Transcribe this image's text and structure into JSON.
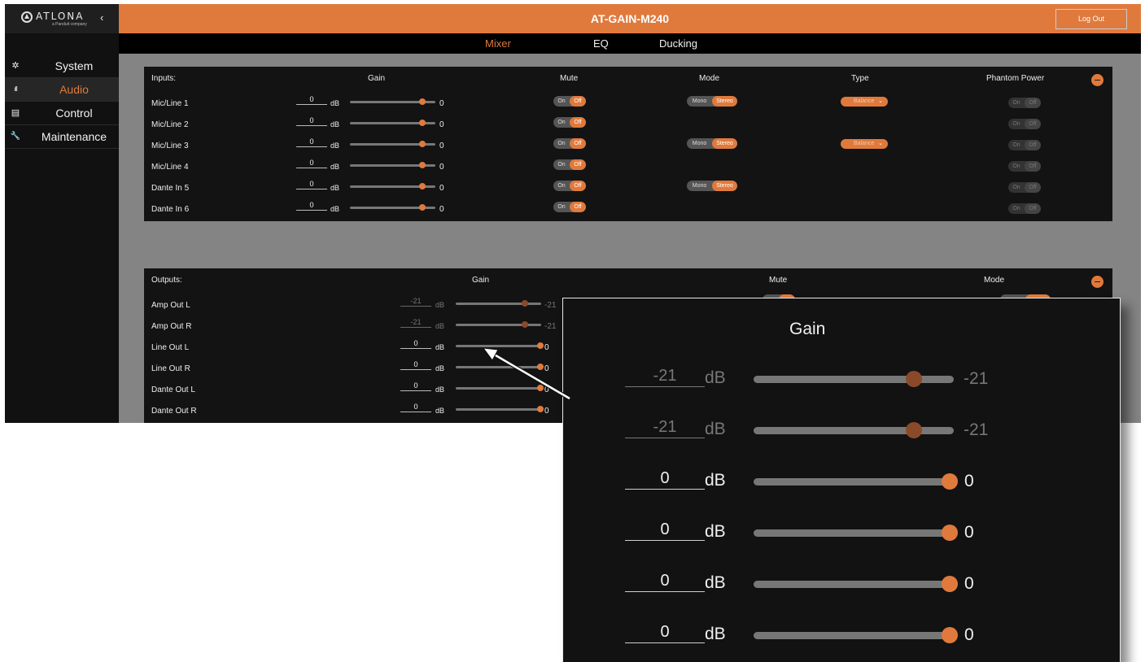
{
  "app": {
    "title": "AT-GAIN-M240",
    "logout_label": "Log Out",
    "brand": "ATLONA",
    "brand_sub": "a Panduit company",
    "accent_color": "#e07a3c"
  },
  "sidebar": {
    "collapse_glyph": "‹",
    "items": [
      {
        "label": "System",
        "icon": "gear-icon",
        "glyph": "✲",
        "active": false
      },
      {
        "label": "Audio",
        "icon": "audio-waveform-icon",
        "glyph": "ıII",
        "active": true
      },
      {
        "label": "Control",
        "icon": "clipboard-icon",
        "glyph": "▤",
        "active": false
      },
      {
        "label": "Maintenance",
        "icon": "wrench-icon",
        "glyph": "🔧",
        "active": false
      }
    ]
  },
  "tabs": [
    {
      "label": "Mixer",
      "active": true
    },
    {
      "label": "EQ",
      "active": false
    },
    {
      "label": "Ducking",
      "active": false
    }
  ],
  "inputs": {
    "headers": {
      "section": "Inputs:",
      "gain": "Gain",
      "mute": "Mute",
      "mode": "Mode",
      "type": "Type",
      "phantom": "Phantom Power"
    },
    "rows": [
      {
        "label": "Mic/Line 1",
        "gain": "0",
        "unit": "dB",
        "readout": "0",
        "level": 1.0,
        "mute": {
          "on": "On",
          "off": "Off"
        },
        "mode": {
          "a": "Mono",
          "b": "Stereo"
        },
        "type": "Balance",
        "phantom": {
          "on": "On",
          "off": "Off"
        }
      },
      {
        "label": "Mic/Line 2",
        "gain": "0",
        "unit": "dB",
        "readout": "0",
        "level": 1.0,
        "mute": {
          "on": "On",
          "off": "Off"
        },
        "phantom": {
          "on": "On",
          "off": "Off"
        }
      },
      {
        "label": "Mic/Line 3",
        "gain": "0",
        "unit": "dB",
        "readout": "0",
        "level": 1.0,
        "mute": {
          "on": "On",
          "off": "Off"
        },
        "mode": {
          "a": "Mono",
          "b": "Stereo"
        },
        "type": "Balance",
        "phantom": {
          "on": "On",
          "off": "Off"
        }
      },
      {
        "label": "Mic/Line 4",
        "gain": "0",
        "unit": "dB",
        "readout": "0",
        "level": 1.0,
        "mute": {
          "on": "On",
          "off": "Off"
        },
        "phantom": {
          "on": "On",
          "off": "Off"
        }
      },
      {
        "label": "Dante In 5",
        "gain": "0",
        "unit": "dB",
        "readout": "0",
        "level": 1.0,
        "mute": {
          "on": "On",
          "off": "Off"
        },
        "mode": {
          "a": "Mono",
          "b": "Stereo"
        },
        "phantom": {
          "on": "On",
          "off": "Off"
        }
      },
      {
        "label": "Dante In 6",
        "gain": "0",
        "unit": "dB",
        "readout": "0",
        "level": 1.0,
        "mute": {
          "on": "On",
          "off": "Off"
        },
        "phantom": {
          "on": "On",
          "off": "Off"
        }
      }
    ]
  },
  "outputs": {
    "headers": {
      "section": "Outputs:",
      "gain": "Gain",
      "mute": "Mute",
      "mode": "Mode"
    },
    "rows": [
      {
        "label": "Amp Out L",
        "gain": "-21",
        "unit": "dB",
        "readout": "-21",
        "level": 0.82,
        "disabled": true
      },
      {
        "label": "Amp Out R",
        "gain": "-21",
        "unit": "dB",
        "readout": "-21",
        "level": 0.82,
        "disabled": true
      },
      {
        "label": "Line Out L",
        "gain": "0",
        "unit": "dB",
        "readout": "0",
        "level": 1.0,
        "disabled": false
      },
      {
        "label": "Line Out R",
        "gain": "0",
        "unit": "dB",
        "readout": "0",
        "level": 1.0,
        "disabled": false
      },
      {
        "label": "Dante Out L",
        "gain": "0",
        "unit": "dB",
        "readout": "0",
        "level": 1.0,
        "disabled": false
      },
      {
        "label": "Dante Out R",
        "gain": "0",
        "unit": "dB",
        "readout": "0",
        "level": 1.0,
        "disabled": false
      }
    ]
  },
  "zoom": {
    "title": "Gain"
  }
}
